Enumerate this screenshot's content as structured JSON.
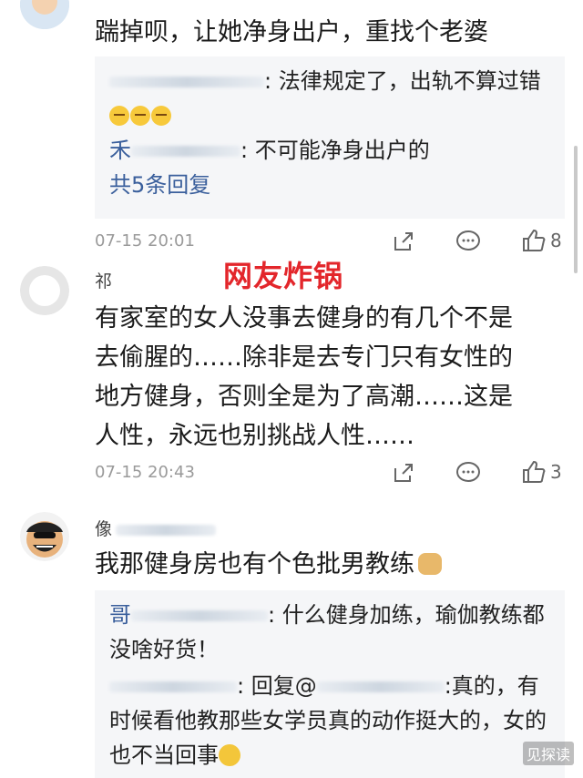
{
  "highlight": "网友炸锅",
  "watermark": "见探读",
  "comment1": {
    "text": "踹掉呗，让她净身出户，重找个老婆",
    "replies": [
      {
        "name_visible": "",
        "text": ": 法律规定了，出轨不算过错"
      },
      {
        "name_visible": "禾",
        "text": ": 不可能净身出户的"
      }
    ],
    "more_label": "共5条回复",
    "time": "07-15 20:01",
    "like_count": "8"
  },
  "comment2": {
    "name_visible": "祁",
    "lines": [
      "有家室的女人没事去健身的有几个不是",
      "去偷腥的……除非是去专门只有女性的",
      "地方健身，否则全是为了高潮……这是",
      "人性，永远也别挑战人性……"
    ],
    "time": "07-15 20:43",
    "like_count": "3"
  },
  "comment3": {
    "name_visible": "像",
    "text": "我那健身房也有个色批男教练",
    "replies": [
      {
        "name_visible": "哥",
        "text": ": 什么健身加练，瑜伽教练都没啥好货！"
      },
      {
        "prefix": ": 回复@",
        "text": ":真的，有时候看他教那些女学员真的动作挺大的，女的也不当回事"
      }
    ]
  },
  "icons": {
    "share": "share-icon",
    "comment": "comment-icon",
    "like": "thumbs-up-icon"
  }
}
